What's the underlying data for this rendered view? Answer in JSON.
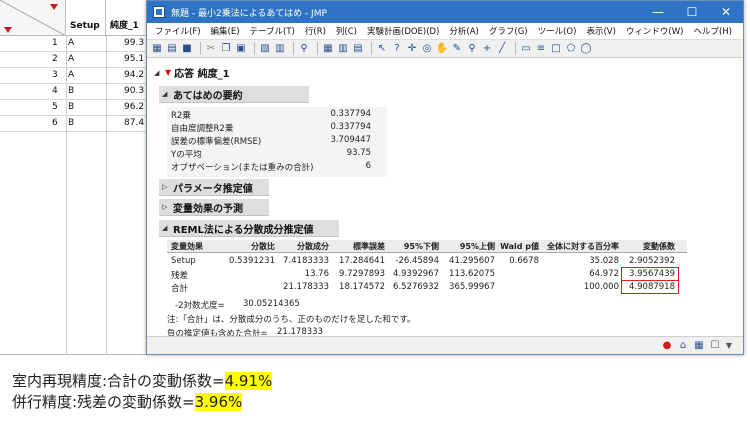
{
  "datatable": {
    "col_setup": "Setup",
    "col_purity": "純度_1",
    "rows": [
      {
        "num": "1",
        "setup": "A",
        "value": "99.3"
      },
      {
        "num": "2",
        "setup": "A",
        "value": "95.1"
      },
      {
        "num": "3",
        "setup": "A",
        "value": "94.2"
      },
      {
        "num": "4",
        "setup": "B",
        "value": "90.3"
      },
      {
        "num": "5",
        "setup": "B",
        "value": "96.2"
      },
      {
        "num": "6",
        "setup": "B",
        "value": "87.4"
      }
    ]
  },
  "window": {
    "title": "無題 - 最小2乗法によるあてはめ - JMP",
    "controls": {
      "minimize": "—",
      "maximize": "☐",
      "close": "✕"
    }
  },
  "menu": [
    "ファイル(F)",
    "編集(E)",
    "テーブル(T)",
    "行(R)",
    "列(C)",
    "実験計画(DOE)(D)",
    "分析(A)",
    "グラフ(G)",
    "ツール(O)",
    "表示(V)",
    "ウィンドウ(W)",
    "ヘルプ(H)"
  ],
  "report": {
    "response_title": "応答 純度_1",
    "summary": {
      "title": "あてはめの要約",
      "rows": [
        {
          "label": "R2乗",
          "value": "0.337794"
        },
        {
          "label": "自由度調整R2乗",
          "value": "0.337794"
        },
        {
          "label": "誤差の標準偏差(RMSE)",
          "value": "3.709447"
        },
        {
          "label": "Yの平均",
          "value": "93.75"
        },
        {
          "label": "オブザベーション(または重みの合計)",
          "value": "6"
        }
      ]
    },
    "param_title": "パラメータ推定値",
    "effect_title": "変量効果の予測",
    "reml": {
      "title": "REML法による分散成分推定値",
      "headers": [
        "変量効果",
        "分散比",
        "分散成分",
        "標準誤差",
        "95%下側",
        "95%上側",
        "Wald p値",
        "全体に対する百分率",
        "変動係数"
      ],
      "rows": [
        {
          "effect": "Setup",
          "ratio": "0.5391231",
          "component": "7.4183333",
          "se": "17.284641",
          "lower": "-26.45894",
          "upper": "41.295607",
          "wald": "0.6678",
          "pct": "35.028",
          "cv": "2.9052392"
        },
        {
          "effect": "残差",
          "ratio": "",
          "component": "13.76",
          "se": "9.7297893",
          "lower": "4.9392967",
          "upper": "113.62075",
          "wald": "",
          "pct": "64.972",
          "cv": "3.9567439"
        },
        {
          "effect": "合計",
          "ratio": "",
          "component": "21.178333",
          "se": "18.174572",
          "lower": "6.5276932",
          "upper": "365.99967",
          "wald": "",
          "pct": "100.000",
          "cv": "4.9087918"
        }
      ],
      "loglik_label": "-2対数尤度=",
      "loglik_value": "30.05214365",
      "note1": "注:「合計」は、分散成分のうち、正のものだけを足した和です。",
      "note2_label": "負の推定値も含めた合計=",
      "note2_value": "21.178333"
    }
  },
  "captions": {
    "line1_prefix": "室内再現精度:合計の変動係数=",
    "line1_value": "4.91%",
    "line2_prefix": "併行精度:残差の変動係数=",
    "line2_value": "3.96%"
  },
  "colors": {
    "titlebar": "#2f74c4",
    "highlight": "#ffff00",
    "redbox": "#e02020"
  }
}
